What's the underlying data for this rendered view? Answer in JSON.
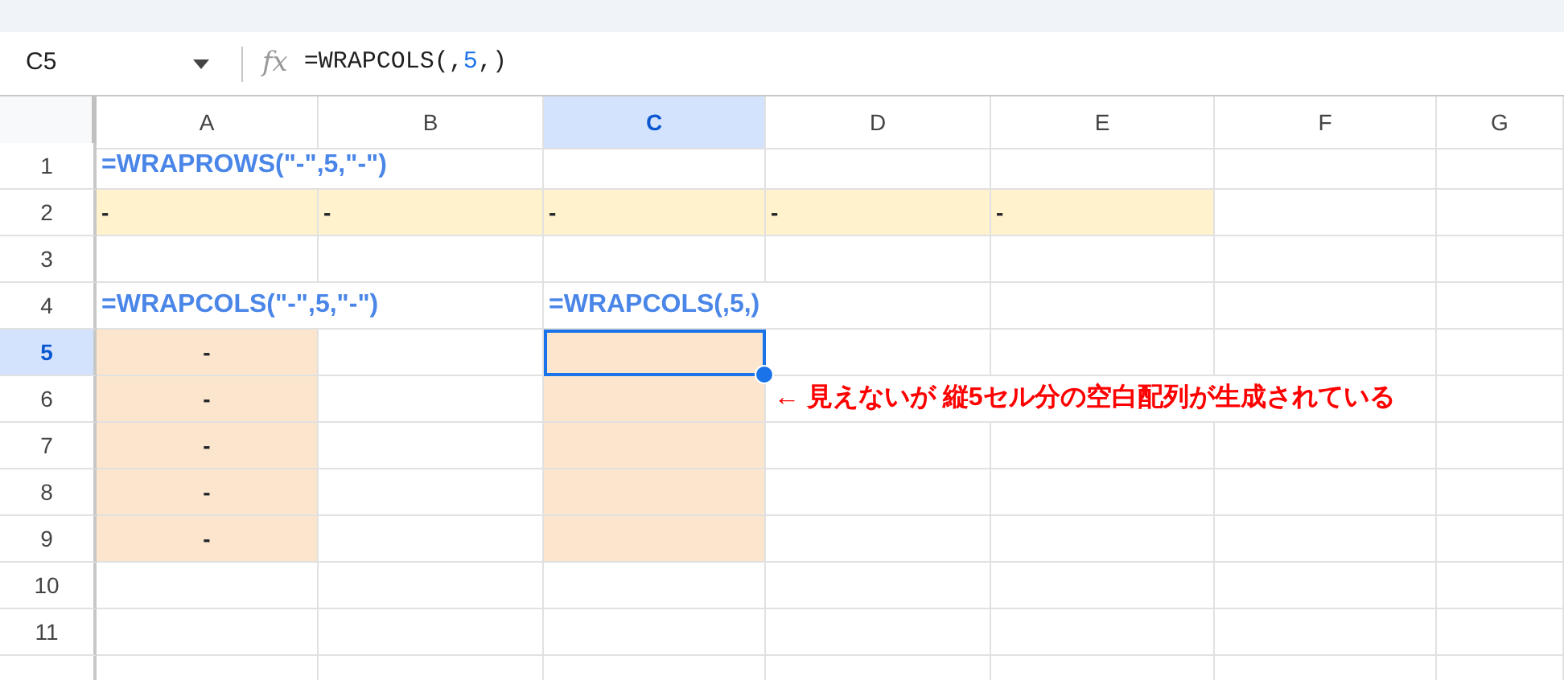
{
  "name_box": "C5",
  "function_label": "fx",
  "formula": [
    {
      "text": "=WRAPCOLS(,",
      "kind": "plain"
    },
    {
      "text": "5",
      "kind": "number"
    },
    {
      "text": ",)",
      "kind": "plain"
    }
  ],
  "columns": [
    {
      "label": "A",
      "selected": false
    },
    {
      "label": "B",
      "selected": false
    },
    {
      "label": "C",
      "selected": true
    },
    {
      "label": "D",
      "selected": false
    },
    {
      "label": "E",
      "selected": false
    },
    {
      "label": "F",
      "selected": false
    },
    {
      "label": "G",
      "selected": false
    }
  ],
  "rows": [
    {
      "label": "1",
      "selected": false,
      "cells": [
        {
          "text": "=WRAPROWS(\"-\",5,\"-\")",
          "kind": "formula"
        },
        {},
        {},
        {},
        {},
        {},
        {}
      ]
    },
    {
      "label": "2",
      "selected": false,
      "cells": [
        {
          "text": "-",
          "kind": "value",
          "color": "#fff2cc"
        },
        {
          "text": "-",
          "kind": "value",
          "color": "#fff2cc"
        },
        {
          "text": "-",
          "kind": "value",
          "color": "#fff2cc"
        },
        {
          "text": "-",
          "kind": "value",
          "color": "#fff2cc"
        },
        {
          "text": "-",
          "kind": "value",
          "color": "#fff2cc"
        },
        {},
        {}
      ]
    },
    {
      "label": "3",
      "selected": false,
      "cells": [
        {},
        {},
        {},
        {},
        {},
        {},
        {}
      ]
    },
    {
      "label": "4",
      "selected": false,
      "cells": [
        {
          "text": "=WRAPCOLS(\"-\",5,\"-\")",
          "kind": "formula"
        },
        {},
        {
          "text": "=WRAPCOLS(,5,)",
          "kind": "formula"
        },
        {},
        {},
        {},
        {}
      ]
    },
    {
      "label": "5",
      "selected": true,
      "cells": [
        {
          "text": "-",
          "kind": "centered",
          "color": "#fce5cd"
        },
        {},
        {
          "color": "#fce5cd"
        },
        {},
        {},
        {},
        {}
      ]
    },
    {
      "label": "6",
      "selected": false,
      "cells": [
        {
          "text": "-",
          "kind": "centered",
          "color": "#fce5cd"
        },
        {},
        {
          "color": "#fce5cd"
        },
        {
          "text": "← 見えないが 縦5セル分の空白配列が生成されている",
          "kind": "note"
        },
        {},
        {},
        {}
      ]
    },
    {
      "label": "7",
      "selected": false,
      "cells": [
        {
          "text": "-",
          "kind": "centered",
          "color": "#fce5cd"
        },
        {},
        {
          "color": "#fce5cd"
        },
        {},
        {},
        {},
        {}
      ]
    },
    {
      "label": "8",
      "selected": false,
      "cells": [
        {
          "text": "-",
          "kind": "centered",
          "color": "#fce5cd"
        },
        {},
        {
          "color": "#fce5cd"
        },
        {},
        {},
        {},
        {}
      ]
    },
    {
      "label": "9",
      "selected": false,
      "cells": [
        {
          "text": "-",
          "kind": "centered",
          "color": "#fce5cd"
        },
        {},
        {
          "color": "#fce5cd"
        },
        {},
        {},
        {},
        {}
      ]
    },
    {
      "label": "10",
      "selected": false,
      "cells": [
        {},
        {},
        {},
        {},
        {},
        {},
        {}
      ]
    },
    {
      "label": "11",
      "selected": false,
      "cells": [
        {},
        {},
        {},
        {},
        {},
        {},
        {}
      ]
    }
  ]
}
